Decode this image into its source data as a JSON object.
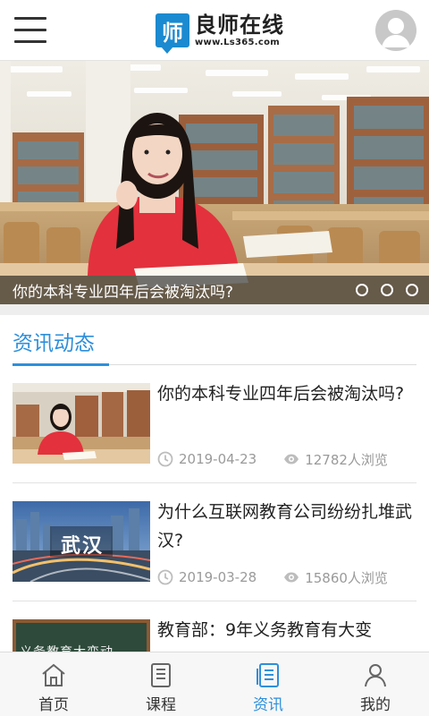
{
  "header": {
    "logo_mark": "师",
    "logo_name": "良师在线",
    "logo_url": "www.Ls365.com",
    "menu_icon": "hamburger-menu-icon",
    "avatar_icon": "user-avatar-icon"
  },
  "banner": {
    "caption": "你的本科专业四年后会被淘汰吗?",
    "dot_count": 3
  },
  "news": {
    "section_title": "资讯动态",
    "items": [
      {
        "title": "你的本科专业四年后会被淘汰吗?",
        "date": "2019-04-23",
        "views": "12782人浏览",
        "thumb_icon": "student-library-thumbnail"
      },
      {
        "title": "为什么互联网教育公司纷纷扎堆武汉?",
        "date": "2019-03-28",
        "views": "15860人浏览",
        "thumb_label": "武汉",
        "thumb_icon": "wuhan-city-thumbnail"
      },
      {
        "title": "教育部：9年义务教育有大变",
        "thumb_label": "义务教育大变动",
        "thumb_icon": "blackboard-thumbnail"
      }
    ]
  },
  "tabbar": {
    "tabs": [
      {
        "label": "首页",
        "icon": "home-icon",
        "active": false
      },
      {
        "label": "课程",
        "icon": "course-book-icon",
        "active": false
      },
      {
        "label": "资讯",
        "icon": "news-list-icon",
        "active": true
      },
      {
        "label": "我的",
        "icon": "profile-icon",
        "active": false
      }
    ]
  },
  "colors": {
    "accent": "#2e8fdb",
    "brand": "#1b8ad0",
    "text": "#222222",
    "muted": "#9a9a9a"
  }
}
